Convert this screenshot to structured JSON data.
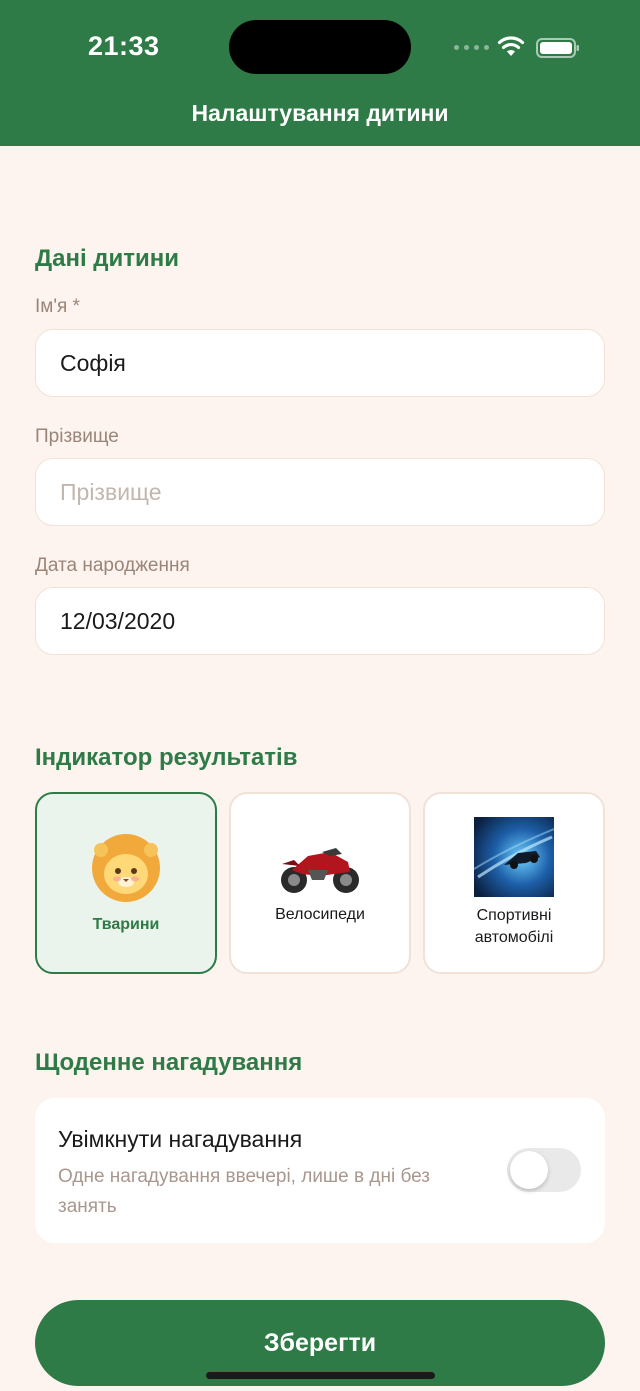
{
  "status_bar": {
    "time": "21:33"
  },
  "header": {
    "title": "Налаштування дитини"
  },
  "child": {
    "section_title": "Дані дитини",
    "first_name": {
      "label": "Ім'я *",
      "value": "Софія"
    },
    "last_name": {
      "label": "Прізвище",
      "value": "",
      "placeholder": "Прізвище"
    },
    "birth_date": {
      "label": "Дата народження",
      "value": "12/03/2020"
    }
  },
  "indicator": {
    "section_title": "Індикатор результатів",
    "options": [
      {
        "label": "Тварини",
        "icon": "lion-icon",
        "selected": true
      },
      {
        "label": "Велосипеди",
        "icon": "motorcycle-icon",
        "selected": false
      },
      {
        "label": "Спортивні автомобілі",
        "icon": "sports-car-icon",
        "selected": false
      }
    ]
  },
  "reminder": {
    "section_title": "Щоденне нагадування",
    "title": "Увімкнути нагадування",
    "description": "Одне нагадування ввечері, лише в дні без занять",
    "enabled": false
  },
  "save_label": "Зберегти",
  "colors": {
    "primary": "#2e7b47",
    "background": "#fdf4ef",
    "selected_bg": "#eaf4ec"
  }
}
